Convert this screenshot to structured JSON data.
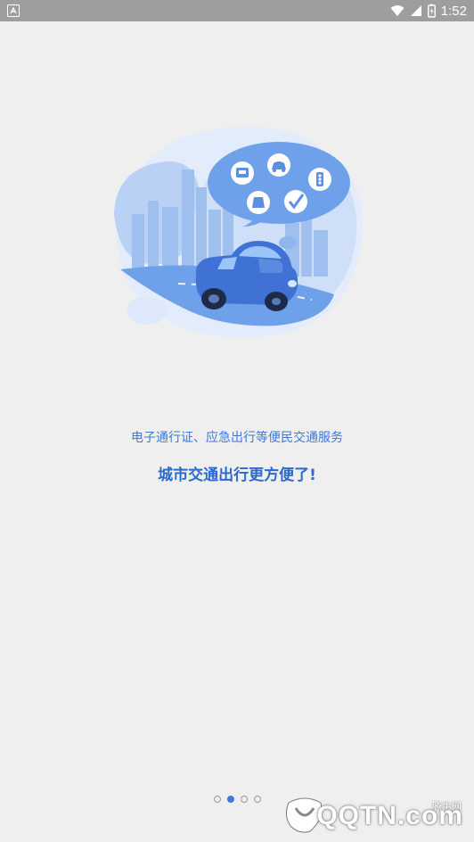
{
  "status_bar": {
    "time": "1:52",
    "icons": [
      "notification-a-icon",
      "wifi-icon",
      "cell-signal-icon",
      "battery-icon"
    ]
  },
  "intro": {
    "subtitle": "电子通行证、应急出行等便民交通服务",
    "title": "城市交通出行更方便了!"
  },
  "pager": {
    "total": 4,
    "active_index": 1
  },
  "watermark": {
    "brand_small": "腾牛网",
    "brand_text": "QQTN.com"
  },
  "colors": {
    "accent": "#3d7ad6",
    "background": "#efefef",
    "status_bar": "#9e9e9e",
    "illustration_blue": "#7fb0ee"
  }
}
